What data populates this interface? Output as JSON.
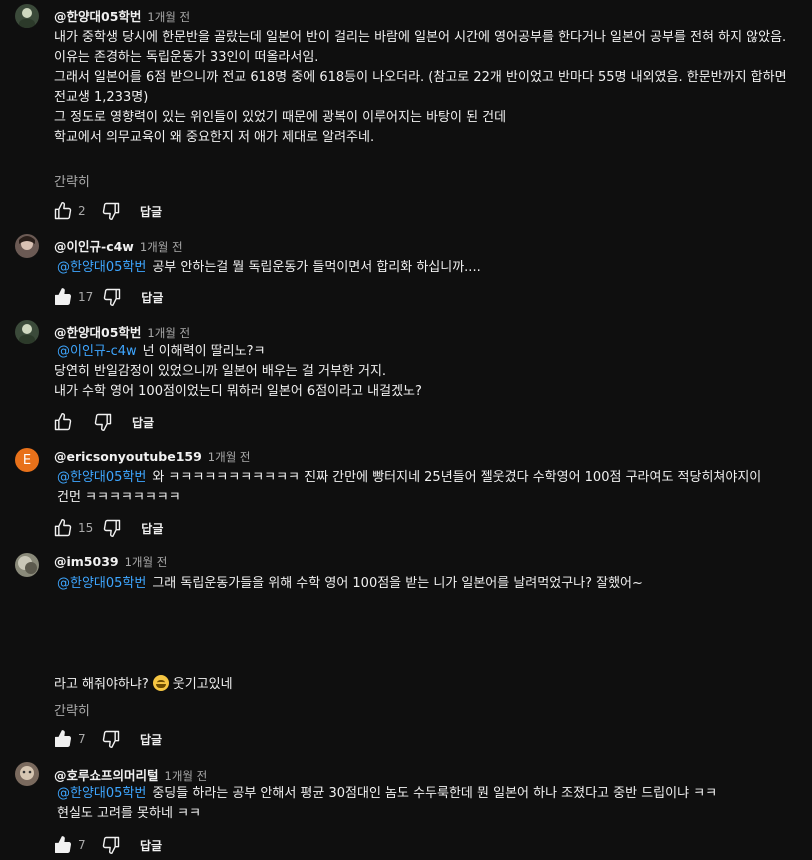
{
  "reply_label": "답글",
  "read_more": "간략히",
  "comments": [
    {
      "author": "@한양대05학번",
      "time": "1개월 전",
      "lines": [
        "내가 중학생 당시에 한문반을 골랐는데 일본어 반이 걸리는 바람에 일본어 시간에 영어공부를 한다거나 일본어 공부를 전혀 하지 않았음.",
        "이유는 존경하는 독립운동가 33인이 떠올라서임.",
        "그래서 일본어를 6점 받으니까 전교 618명 중에 618등이 나오더라. (참고로 22개 반이었고 반마다 55명 내외였음. 한문반까지 합하면 전교생 1,233명)",
        "그 정도로 영향력이 있는 위인들이 있었기 때문에 광복이 이루어지는 바탕이 된 건데",
        "학교에서 의무교육이 왜 중요한지 저 애가 제대로 알려주네."
      ],
      "likes": "2",
      "avatar_color": "#3b4a3a"
    },
    {
      "author": "@이인규-c4w",
      "time": "1개월 전",
      "mention": "@한양대05학번",
      "lines": [
        "공부 안하는걸 뭘 독립운동가 들먹이면서 합리화 하십니까...."
      ],
      "likes": "17",
      "avatar_color": "#6b5a54"
    },
    {
      "author": "@한양대05학번",
      "time": "1개월 전",
      "mention": "@이인규-c4w",
      "lines": [
        "넌 이해력이 딸리노?ㅋ",
        "당연히 반일감정이 있었으니까 일본어 배우는 걸 거부한 거지.",
        "내가 수학 영어 100점이었는디 뭐하러 일본어 6점이라고 내걸겠노?"
      ],
      "likes": "",
      "avatar_color": "#3b4a3a"
    },
    {
      "author": "@ericsonyoutube159",
      "time": "1개월 전",
      "avatar_letter": "E",
      "mention": "@한양대05학번",
      "lines": [
        "와 ㅋㅋㅋㅋㅋㅋㅋㅋㅋㅋㅋ 진짜 간만에 빵터지네 25년들어 젤웃겼다 수학영어 100점 구라여도 적당히쳐야지이건먼 ㅋㅋㅋㅋㅋㅋㅋㅋ"
      ],
      "likes": "15",
      "avatar_color": "#e8711a"
    },
    {
      "author": "@im5039",
      "time": "1개월 전",
      "mention": "@한양대05학번",
      "lines": [
        "그래 독립운동가들을 위해 수학 영어 100점을 받는 니가 일본어를 날려먹었구나? 잘했어~"
      ],
      "tail_before_emoji": "라고 해줘야하냐?",
      "tail_after_emoji": "웃기고있네",
      "likes": "7",
      "avatar_color": "#8a8a7a"
    },
    {
      "author": "@호루쇼프의머리털",
      "time": "1개월 전",
      "mention": "@한양대05학번",
      "lines": [
        "중딩들 하라는 공부 안해서 평균 30점대인 놈도 수두룩한데 뭔 일본어 하나 조졌다고 중반 드립이냐 ㅋㅋ",
        "현실도 고려를 못하네 ㅋㅋ"
      ],
      "likes": "7",
      "avatar_color": "#7a6a5e"
    }
  ]
}
